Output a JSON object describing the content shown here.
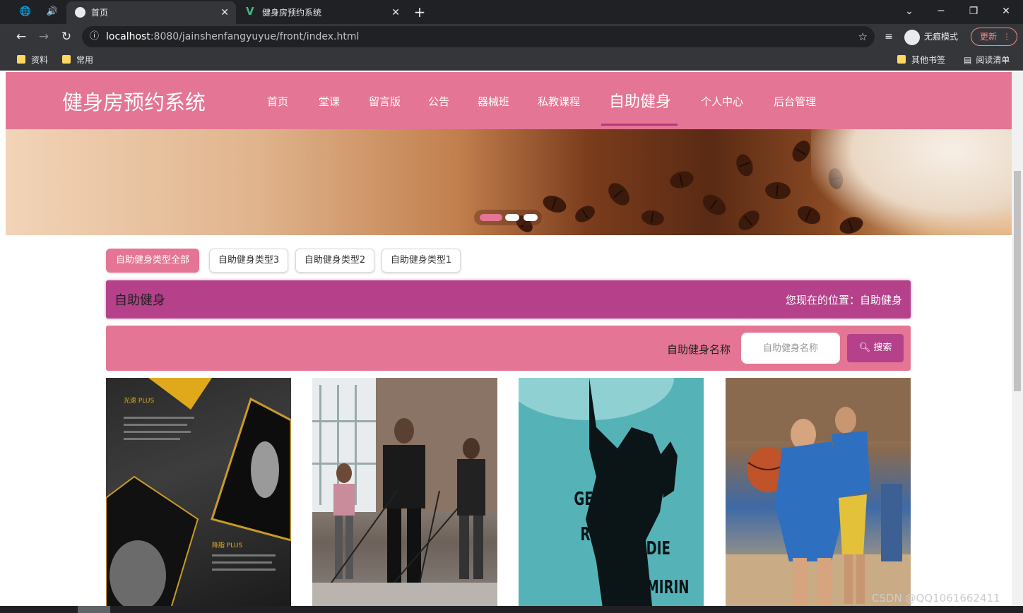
{
  "browser": {
    "tabs": [
      {
        "title": "首页",
        "active": true
      },
      {
        "title": "健身房预约系统",
        "active": false
      }
    ],
    "url_host": "localhost",
    "url_rest": ":8080/jainshenfangyuyue/front/index.html",
    "incognito_label": "无痕模式",
    "update_label": "更新",
    "bookmarks": [
      "资料",
      "常用"
    ],
    "bookmarks_right": [
      "其他书签",
      "阅读清单"
    ]
  },
  "site": {
    "title": "健身房预约系统",
    "menu": [
      "首页",
      "堂课",
      "留言版",
      "公告",
      "器械班",
      "私教课程",
      "自助健身",
      "个人中心",
      "后台管理"
    ],
    "active_menu": "自助健身"
  },
  "banner": {
    "slide_count": 3,
    "active_slide": 1
  },
  "categories": [
    "自助健身类型全部",
    "自助健身类型3",
    "自助健身类型2",
    "自助健身类型1"
  ],
  "section": {
    "title": "自助健身",
    "location": "您现在的位置：自助健身"
  },
  "search": {
    "label": "自助健身名称",
    "placeholder": "自助健身名称",
    "button": "搜索"
  },
  "cards": [
    {
      "image": "gym-poster-dark"
    },
    {
      "image": "resistance-band-class"
    },
    {
      "image": "get-ripped-or-die-mirin-poster"
    },
    {
      "image": "basketball-players"
    }
  ],
  "card3_text": {
    "line1": "GET",
    "line2": "RIPPED",
    "line3": "OR",
    "line4": "DIE",
    "line5": "MIRIN"
  },
  "card1_text": {
    "label1": "光速 PLUS",
    "label2": "降脂 PLUS"
  },
  "watermark": "CSDN @QQ1061662411",
  "colors": {
    "header": "#e57594",
    "accent": "#b4418a",
    "chrome_dark": "#202124",
    "chrome": "#35363a"
  }
}
